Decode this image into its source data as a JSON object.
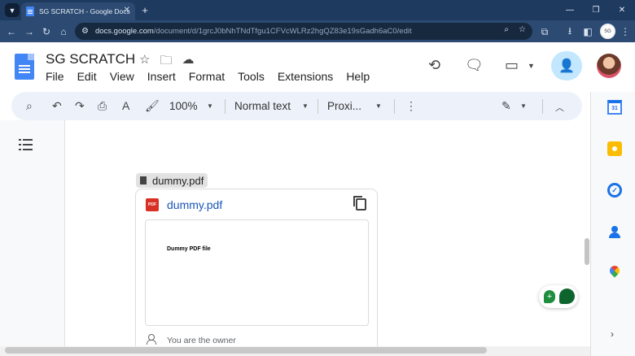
{
  "browser": {
    "tab_title": "SG SCRATCH - Google Docs",
    "url_host": "docs.google.com",
    "url_path": "/document/d/1grcJ0bNhTNdTfgu1CFVcWLRz2hgQZ83e19sGadh6aC0/edit",
    "profile_initials": "SG"
  },
  "doc": {
    "title": "SG SCRATCH",
    "menu": [
      "File",
      "Edit",
      "View",
      "Insert",
      "Format",
      "Tools",
      "Extensions",
      "Help"
    ]
  },
  "toolbar": {
    "zoom": "100%",
    "style": "Normal text",
    "font": "Proxi..."
  },
  "attachment": {
    "chip_label": "dummy.pdf",
    "badge": "PDF",
    "card_title": "dummy.pdf",
    "preview_text": "Dummy PDF file",
    "owner_text": "You are the owner"
  },
  "side_panel": {
    "calendar_day": "31"
  },
  "colors": {
    "browser_chrome": "#1f3a5f",
    "toolbar_bg": "#edf2fa",
    "share_bg": "#c2e7ff",
    "link_blue": "#1a56b8",
    "pdf_red": "#d93025"
  },
  "icons": [
    "search-icon",
    "undo-icon",
    "redo-icon",
    "print-icon",
    "spellcheck-icon",
    "paint-format-icon",
    "more-vert-icon",
    "pencil-icon",
    "chevron-up-icon",
    "history-icon",
    "comment-icon",
    "meet-icon",
    "share-icon",
    "star-icon",
    "move-folder-icon",
    "cloud-icon",
    "outline-icon",
    "copy-icon"
  ]
}
